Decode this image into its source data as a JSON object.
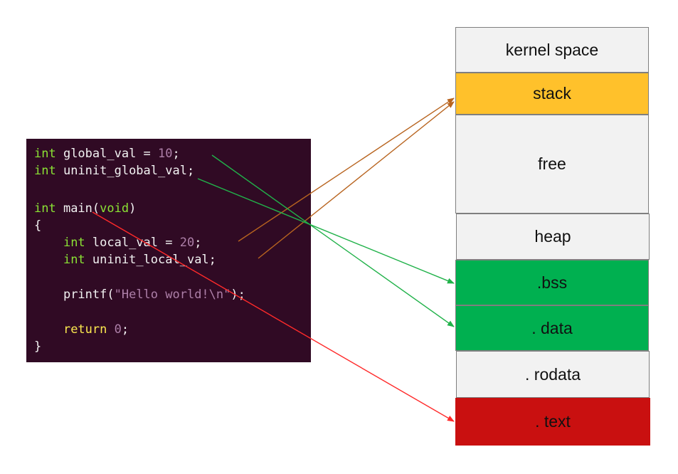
{
  "code": {
    "line1": {
      "type": "int",
      "rest": " global_val = ",
      "num": "10",
      "end": ";"
    },
    "line2": {
      "type": "int",
      "rest": " uninit_global_val;"
    },
    "line3": {
      "type": "int",
      "rest": " main(",
      "arg": "void",
      "end": ")"
    },
    "line4": {
      "text": "{"
    },
    "line5": {
      "indent": "    ",
      "type": "int",
      "rest": " local_val = ",
      "num": "20",
      "end": ";"
    },
    "line6": {
      "indent": "    ",
      "type": "int",
      "rest": " uninit_local_val;"
    },
    "line7": {
      "indent": "    ",
      "fn": "printf(",
      "str": "\"Hello world!\\n\"",
      "end": ");"
    },
    "line8": {
      "indent": "    ",
      "kw": "return",
      "sp": " ",
      "num": "0",
      "end": ";"
    },
    "line9": {
      "text": "}"
    }
  },
  "memory": {
    "kernel": {
      "label": "kernel space",
      "color": "#f2f2f2"
    },
    "stack": {
      "label": "stack",
      "color": "#ffc12b"
    },
    "free": {
      "label": "free",
      "color": "#f2f2f2"
    },
    "heap": {
      "label": "heap",
      "color": "#f2f2f2"
    },
    "bss": {
      "label": ".bss",
      "color": "#00b050"
    },
    "data": {
      "label": ". data",
      "color": "#00b050"
    },
    "rodata": {
      "label": ". rodata",
      "color": "#f2f2f2"
    },
    "text": {
      "label": ". text",
      "color": "#c91010"
    }
  },
  "arrow_colors": {
    "stack": "#b8641f",
    "data": "#21b24a",
    "text": "#ff2a2a"
  }
}
